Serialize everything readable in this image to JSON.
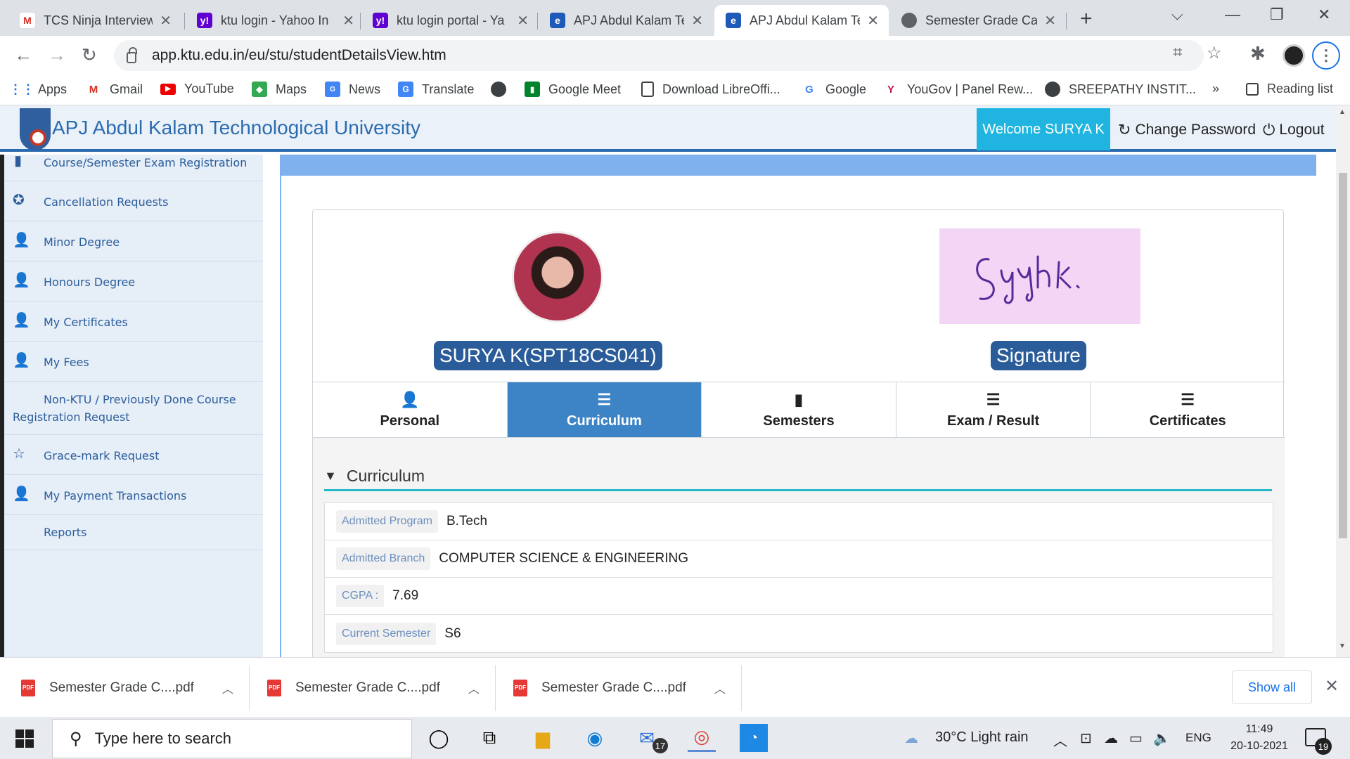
{
  "browser": {
    "tabs": [
      {
        "title": "TCS Ninja Interview",
        "icon": "gmail-icon",
        "color": "#d93025"
      },
      {
        "title": "ktu login - Yahoo In",
        "icon": "yahoo-icon",
        "color": "#6001d2"
      },
      {
        "title": "ktu login portal - Ya",
        "icon": "yahoo-icon",
        "color": "#6001d2"
      },
      {
        "title": "APJ Abdul Kalam Te",
        "icon": "edge-legacy-icon",
        "color": "#1e5bb8"
      },
      {
        "title": "APJ Abdul Kalam Te",
        "icon": "edge-legacy-icon",
        "color": "#1e5bb8"
      },
      {
        "title": "Semester Grade Ca",
        "icon": "globe-icon",
        "color": "#5f6368"
      }
    ],
    "url": "app.ktu.edu.in/eu/stu/studentDetailsView.htm",
    "bookmarks": [
      {
        "label": "Apps"
      },
      {
        "label": "Gmail"
      },
      {
        "label": "YouTube"
      },
      {
        "label": "Maps"
      },
      {
        "label": "News"
      },
      {
        "label": "Translate"
      },
      {
        "label": ""
      },
      {
        "label": "Google Meet"
      },
      {
        "label": "Download LibreOffi..."
      },
      {
        "label": "Google"
      },
      {
        "label": "YouGov | Panel Rew..."
      },
      {
        "label": "SREEPATHY INSTIT..."
      }
    ],
    "bookmarks_more": "»",
    "reading_list": "Reading list"
  },
  "site": {
    "title": "APJ Abdul Kalam Technological University",
    "welcome": "Welcome SURYA K",
    "change_password": "Change Password",
    "logout": "Logout"
  },
  "sidebar": {
    "items": [
      {
        "label": "Course/Semester Exam Registration",
        "icon": "book-icon"
      },
      {
        "label": "Cancellation Requests",
        "icon": "gear-icon"
      },
      {
        "label": "Minor Degree",
        "icon": "user-icon"
      },
      {
        "label": "Honours Degree",
        "icon": "user-icon"
      },
      {
        "label": "My Certificates",
        "icon": "user-icon"
      },
      {
        "label": "My Fees",
        "icon": "user-icon"
      },
      {
        "label": "Non-KTU / Previously Done Course",
        "label2": "Registration Request",
        "icon": ""
      },
      {
        "label": "Grace-mark Request",
        "icon": "star-icon"
      },
      {
        "label": "My Payment Transactions",
        "icon": "user-icon"
      },
      {
        "label": "Reports",
        "icon": ""
      }
    ]
  },
  "profile": {
    "name": "SURYA K(SPT18CS041)",
    "signature_label": "Signature",
    "signature_text": "Surya.k.",
    "tabs": [
      {
        "label": "Personal",
        "icon": "user-icon"
      },
      {
        "label": "Curriculum",
        "icon": "list-icon"
      },
      {
        "label": "Semesters",
        "icon": "book-icon"
      },
      {
        "label": "Exam / Result",
        "icon": "list-icon"
      },
      {
        "label": "Certificates",
        "icon": "list-icon"
      }
    ],
    "active_tab": "Curriculum"
  },
  "curriculum": {
    "heading": "Curriculum",
    "rows": [
      {
        "label": "Admitted Program",
        "value": "B.Tech"
      },
      {
        "label": "Admitted Branch",
        "value": "COMPUTER SCIENCE & ENGINEERING"
      },
      {
        "label": "CGPA :",
        "value": "7.69"
      },
      {
        "label": "Current Semester",
        "value": "S6"
      }
    ]
  },
  "downloads": {
    "items": [
      {
        "name": "Semester Grade C....pdf"
      },
      {
        "name": "Semester Grade C....pdf"
      },
      {
        "name": "Semester Grade C....pdf"
      }
    ],
    "pdf_tag": "PDF",
    "show_all": "Show all"
  },
  "taskbar": {
    "search_placeholder": "Type here to search",
    "mail_badge": "17",
    "weather": "30°C  Light rain",
    "language": "ENG",
    "time": "11:49",
    "date": "20-10-2021",
    "notifications": "19"
  }
}
